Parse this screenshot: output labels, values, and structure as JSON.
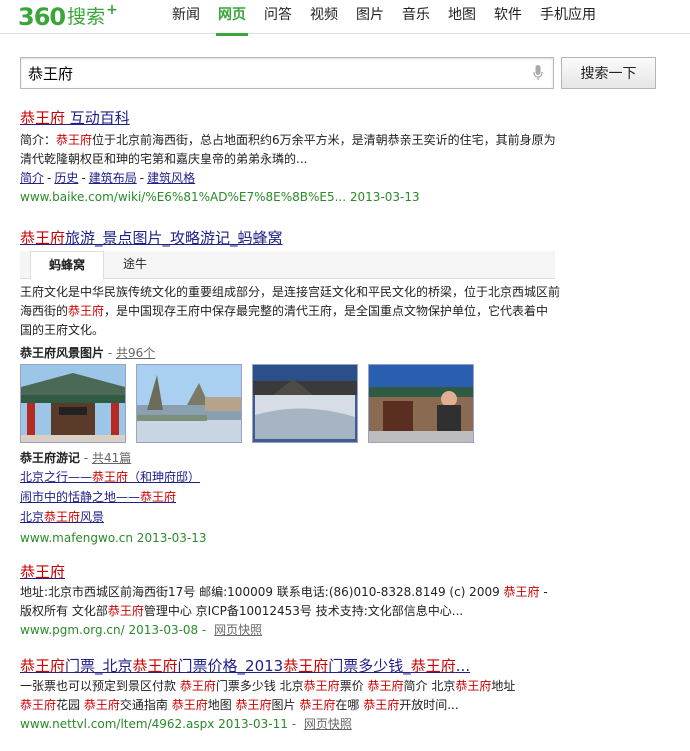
{
  "logo": {
    "num": "360",
    "text": "搜索",
    "plus": "+"
  },
  "nav": [
    "新闻",
    "网页",
    "问答",
    "视频",
    "图片",
    "音乐",
    "地图",
    "软件",
    "手机应用"
  ],
  "nav_active": 1,
  "search": {
    "query": "恭王府",
    "button": "搜索一下"
  },
  "r1": {
    "title_a": "恭王府",
    "title_b": " 互动百科",
    "abs_pre": "简介：",
    "abs_hl": "恭王府",
    "abs_post": "位于北京前海西街，总占地面积约6万余平方米，是清朝恭亲王奕䜣的住宅，其前身原为清代乾隆朝权臣和珅的宅第和嘉庆皇帝的弟弟永璘的...",
    "links": [
      "简介",
      "历史",
      "建筑布局",
      "建筑风格"
    ],
    "url": "www.baike.com/wiki/%E6%81%AD%E7%8E%8B%E5... 2013-03-13"
  },
  "r2": {
    "title_a": "恭王府",
    "title_b": "旅游_景点图片_攻略游记_蚂蜂窝",
    "tabs": [
      "蚂蜂窝",
      "途牛"
    ],
    "abs1": "王府文化是中华民族传统文化的重要组成部分，是连接宫廷文化和平民文化的桥梁，位于北京西城区前海西街的",
    "abs_hl": "恭王府",
    "abs2": "，是中国现存王府中保存最完整的清代王府，是全国重点文物保护单位，它代表着中国的王府文化。",
    "photos_label": "恭王府风景图片",
    "photos_count": "共96个",
    "notes_label": "恭王府游记",
    "notes_count": "共41篇",
    "note1_a": "北京之行——",
    "note1_hl": "恭王府",
    "note1_b": "（和珅府邸）",
    "note2_a": "闹市中的恬静之地——",
    "note2_hl": "恭王府",
    "note3_a": "北京",
    "note3_hl": "恭王府",
    "note3_b": "风景",
    "url": "www.mafengwo.cn 2013-03-13"
  },
  "r3": {
    "title": "恭王府",
    "line1_a": "地址:北京市西城区前海西街17号 邮编:100009 联系电话:(86)010-8328.8149 (c) 2009 ",
    "line1_hl": "恭王府",
    "line1_b": " -",
    "line2_a": "版权所有 文化部",
    "line2_hl": "恭王府",
    "line2_b": "管理中心 京ICP备10012453号 技术支持:文化部信息中心...",
    "url": "www.pgm.org.cn/ 2013-03-08",
    "snap": "网页快照"
  },
  "r4": {
    "title_parts": [
      "恭王府",
      "门票_北京",
      "恭王府",
      "门票价格_2013",
      "恭王府",
      "门票多少钱_",
      "恭王府",
      "..."
    ],
    "line1": [
      "一张票也可以预定到景区付款 ",
      "恭王府",
      "门票多少钱 北京",
      "恭王府",
      "票价 ",
      "恭王府",
      "简介 北京",
      "恭王府",
      "地址"
    ],
    "line2": [
      "恭王府",
      "花园 ",
      "恭王府",
      "交通指南 ",
      "恭王府",
      "地图 ",
      "恭王府",
      "图片 ",
      "恭王府",
      "在哪 ",
      "恭王府",
      "开放时间..."
    ],
    "url": "www.nettvl.com/ltem/4962.aspx 2013-03-11",
    "snap": "网页快照"
  },
  "colors": {
    "green": "#3aa63a",
    "link": "#20208a",
    "highlight": "#cc0000",
    "url": "#2a8a2a"
  }
}
